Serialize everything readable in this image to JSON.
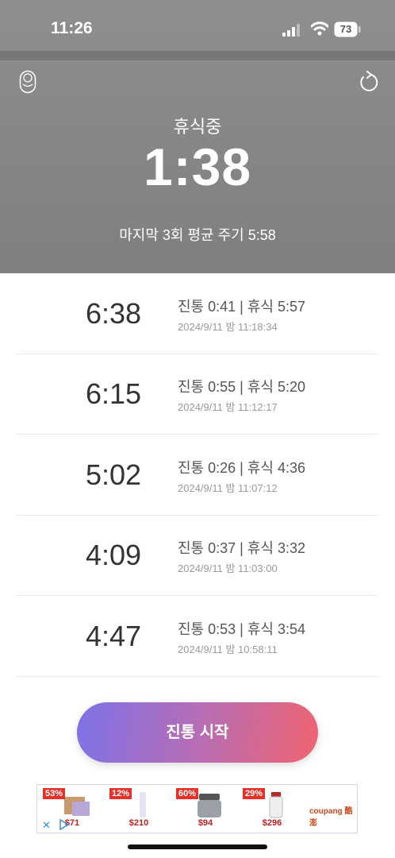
{
  "status_bar": {
    "time": "11:26",
    "battery": "73"
  },
  "header": {
    "status_label": "휴식중",
    "timer": "1:38",
    "average_text": "마지막 3회 평균 주기 5:58"
  },
  "list": {
    "items": [
      {
        "interval": "6:38",
        "detail": "진통 0:41 | 휴식 5:57",
        "timestamp": "2024/9/11 밤 11:18:34"
      },
      {
        "interval": "6:15",
        "detail": "진통 0:55 | 휴식 5:20",
        "timestamp": "2024/9/11 밤 11:12:17"
      },
      {
        "interval": "5:02",
        "detail": "진통 0:26 | 휴식 4:36",
        "timestamp": "2024/9/11 밤 11:07:12"
      },
      {
        "interval": "4:09",
        "detail": "진통 0:37 | 휴식 3:32",
        "timestamp": "2024/9/11 밤 11:03:00"
      },
      {
        "interval": "4:47",
        "detail": "진통 0:53 | 휴식 3:54",
        "timestamp": "2024/9/11 밤 10:58:11"
      }
    ]
  },
  "start_button": {
    "label": "진통 시작"
  },
  "ad": {
    "items": [
      {
        "badge": "53%",
        "price": "$71"
      },
      {
        "badge": "12%",
        "price": "$210"
      },
      {
        "badge": "60%",
        "price": "$94"
      },
      {
        "badge": "29%",
        "price": "$296"
      }
    ],
    "brand": "coupang 酷澎",
    "close": "✕"
  },
  "colors": {
    "header_bg": "#888888",
    "button_start": "#7d72e8",
    "button_end": "#f06470"
  }
}
